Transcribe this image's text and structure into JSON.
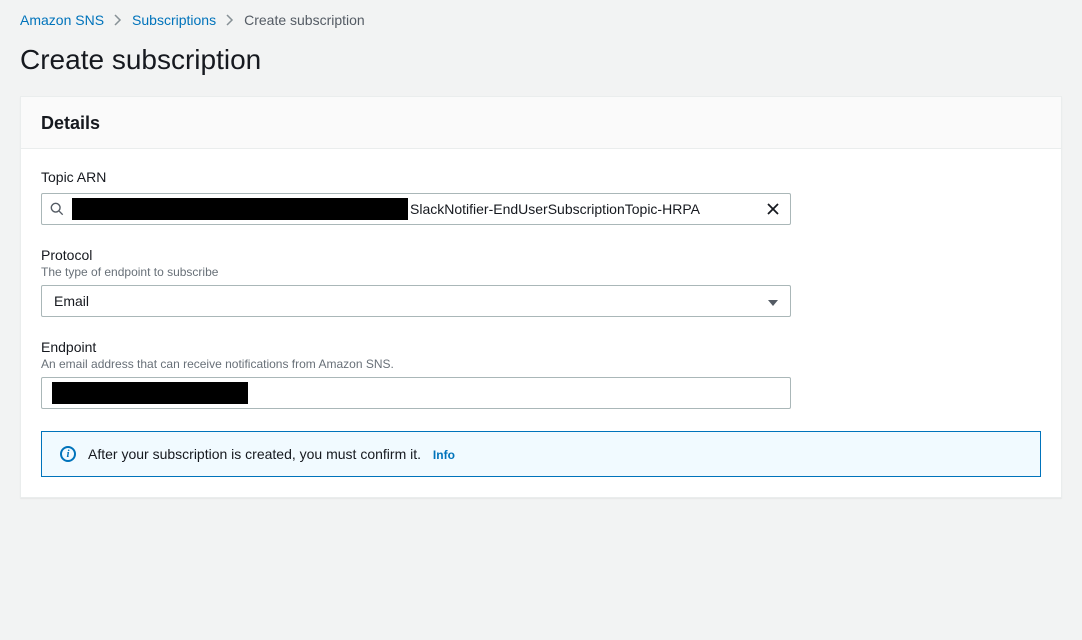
{
  "breadcrumb": {
    "items": [
      {
        "label": "Amazon SNS"
      },
      {
        "label": "Subscriptions"
      }
    ],
    "current": "Create subscription"
  },
  "page_title": "Create subscription",
  "details": {
    "heading": "Details",
    "topic_arn": {
      "label": "Topic ARN",
      "visible_suffix": "SlackNotifier-EndUserSubscriptionTopic-HRPA"
    },
    "protocol": {
      "label": "Protocol",
      "hint": "The type of endpoint to subscribe",
      "selected": "Email"
    },
    "endpoint": {
      "label": "Endpoint",
      "hint": "An email address that can receive notifications from Amazon SNS."
    },
    "info_box": {
      "text": "After your subscription is created, you must confirm it.",
      "link": "Info"
    }
  }
}
